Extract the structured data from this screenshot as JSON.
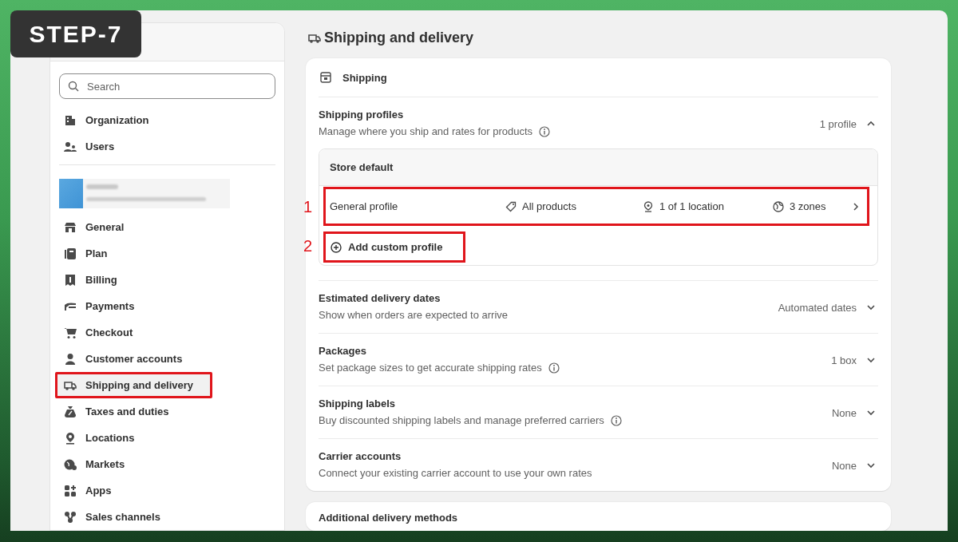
{
  "step_badge": "STEP-7",
  "sidebar": {
    "search": {
      "placeholder": "Search"
    },
    "top_items": [
      {
        "label": "Organization",
        "selected": false,
        "annotated": false
      },
      {
        "label": "Users",
        "selected": false,
        "annotated": false
      }
    ],
    "items": [
      {
        "label": "General",
        "selected": false,
        "annotated": false
      },
      {
        "label": "Plan",
        "selected": false,
        "annotated": false
      },
      {
        "label": "Billing",
        "selected": false,
        "annotated": false
      },
      {
        "label": "Payments",
        "selected": false,
        "annotated": false
      },
      {
        "label": "Checkout",
        "selected": false,
        "annotated": false
      },
      {
        "label": "Customer accounts",
        "selected": false,
        "annotated": false
      },
      {
        "label": "Shipping and delivery",
        "selected": true,
        "annotated": true
      },
      {
        "label": "Taxes and duties",
        "selected": false,
        "annotated": false
      },
      {
        "label": "Locations",
        "selected": false,
        "annotated": false
      },
      {
        "label": "Markets",
        "selected": false,
        "annotated": false
      },
      {
        "label": "Apps",
        "selected": false,
        "annotated": false
      },
      {
        "label": "Sales channels",
        "selected": false,
        "annotated": false
      }
    ]
  },
  "page": {
    "title": "Shipping and delivery"
  },
  "shipping_card": {
    "title": "Shipping",
    "profiles": {
      "title": "Shipping profiles",
      "description": "Manage where you ship and rates for products",
      "info": true,
      "summary": "1 profile",
      "expanded": true,
      "group": {
        "title": "Store default",
        "rows": [
          {
            "name": "General profile",
            "products": "All products",
            "locations": "1 of 1 location",
            "zones": "3 zones",
            "annotation": "1"
          }
        ],
        "add_button": {
          "label": "Add custom profile",
          "annotation": "2"
        }
      }
    },
    "settings": [
      {
        "title": "Estimated delivery dates",
        "description": "Show when orders are expected to arrive",
        "info": false,
        "value": "Automated dates",
        "expanded": false
      },
      {
        "title": "Packages",
        "description": "Set package sizes to get accurate shipping rates",
        "info": true,
        "value": "1 box",
        "expanded": false
      },
      {
        "title": "Shipping labels",
        "description": "Buy discounted shipping labels and manage preferred carriers",
        "info": true,
        "value": "None",
        "expanded": false
      },
      {
        "title": "Carrier accounts",
        "description": "Connect your existing carrier account to use your own rates",
        "info": false,
        "value": "None",
        "expanded": false
      }
    ]
  },
  "next_card": {
    "title": "Additional delivery methods"
  }
}
